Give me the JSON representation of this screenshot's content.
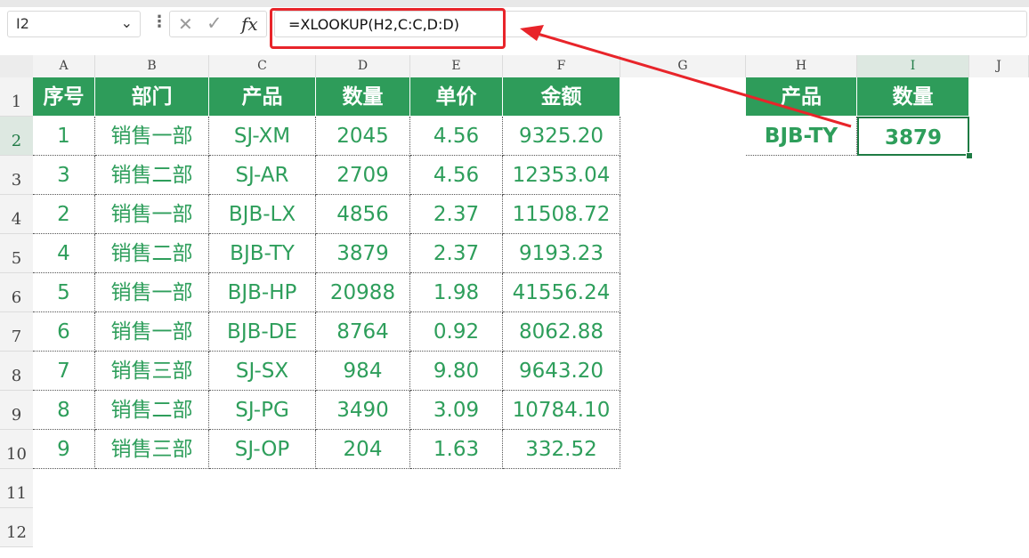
{
  "formula_bar": {
    "name_box": "I2",
    "formula": "=XLOOKUP(H2,C:C,D:D)"
  },
  "icons": {
    "name_box_dropdown": "chevron-down-icon",
    "more": "vertical-dots-icon",
    "cancel": "close-icon",
    "confirm": "checkmark-icon",
    "function": "fx-icon"
  },
  "colors": {
    "header_fill": "#2e9c5a",
    "cell_text": "#2e9e5b",
    "annotation": "#e8242a",
    "selection": "#1e7b43"
  },
  "columns": [
    "A",
    "B",
    "C",
    "D",
    "E",
    "F",
    "G",
    "H",
    "I",
    "J"
  ],
  "rows": [
    "1",
    "2",
    "3",
    "4",
    "5",
    "6",
    "7",
    "8",
    "9",
    "10",
    "11",
    "12"
  ],
  "main_table": {
    "headers": [
      "序号",
      "部门",
      "产品",
      "数量",
      "单价",
      "金额"
    ],
    "rows": [
      [
        "1",
        "销售一部",
        "SJ-XM",
        "2045",
        "4.56",
        "9325.20"
      ],
      [
        "3",
        "销售二部",
        "SJ-AR",
        "2709",
        "4.56",
        "12353.04"
      ],
      [
        "2",
        "销售一部",
        "BJB-LX",
        "4856",
        "2.37",
        "11508.72"
      ],
      [
        "4",
        "销售二部",
        "BJB-TY",
        "3879",
        "2.37",
        "9193.23"
      ],
      [
        "5",
        "销售一部",
        "BJB-HP",
        "20988",
        "1.98",
        "41556.24"
      ],
      [
        "6",
        "销售一部",
        "BJB-DE",
        "8764",
        "0.92",
        "8062.88"
      ],
      [
        "7",
        "销售三部",
        "SJ-SX",
        "984",
        "9.80",
        "9643.20"
      ],
      [
        "8",
        "销售二部",
        "SJ-PG",
        "3490",
        "3.09",
        "10784.10"
      ],
      [
        "9",
        "销售三部",
        "SJ-OP",
        "204",
        "1.63",
        "332.52"
      ]
    ]
  },
  "lookup_table": {
    "headers": [
      "产品",
      "数量"
    ],
    "product": "BJB-TY",
    "result": "3879"
  }
}
